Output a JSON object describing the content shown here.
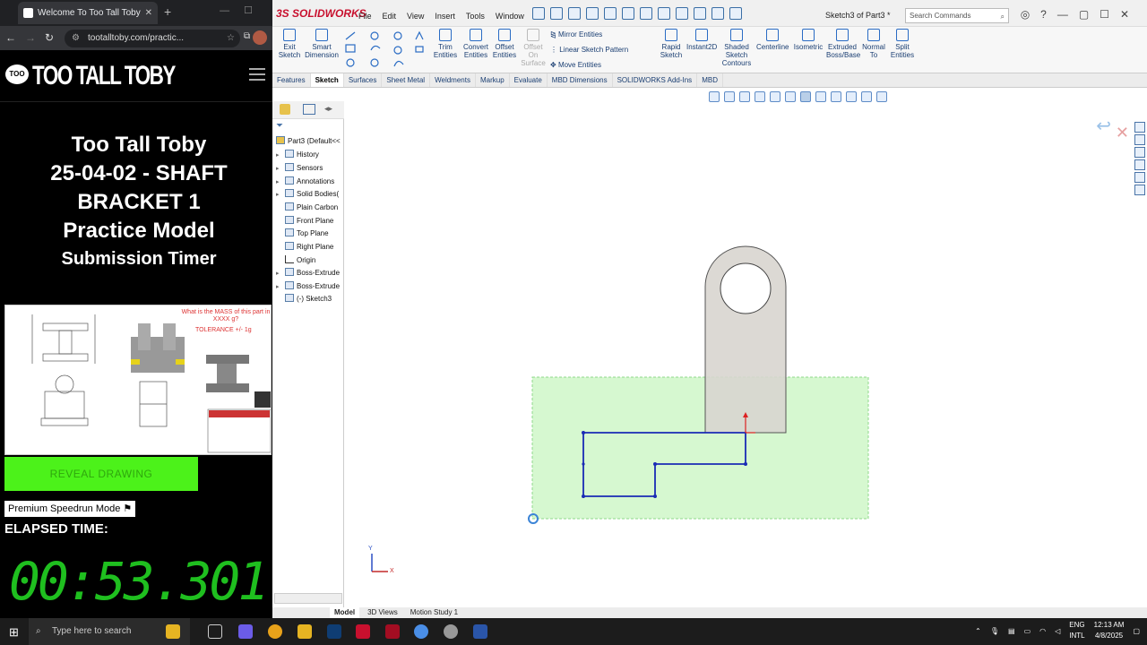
{
  "browser": {
    "tab_title": "Welcome To Too Tall Toby",
    "url": "tootalltoby.com/practic...",
    "logo_badge": "TOO",
    "logo_text": "TOO TALL TOBY",
    "heading_lines": [
      "Too Tall Toby",
      "25-04-02 - SHAFT",
      "BRACKET 1",
      "Practice Model"
    ],
    "subheading": "Submission Timer",
    "reveal_button": "REVEAL DRAWING",
    "speedrun_label": "Premium Speedrun Mode ⚑",
    "elapsed_label": "ELAPSED TIME:",
    "elapsed_value": "00:53.301",
    "drawing_question": "What is the MASS of this part in XXXX g?",
    "drawing_tolerance": "TOLERANCE +/- 1g"
  },
  "solidworks": {
    "brand": "3S SOLIDWORKS",
    "menus": [
      "File",
      "Edit",
      "View",
      "Insert",
      "Tools",
      "Window"
    ],
    "doc_title": "Sketch3 of Part3 *",
    "search_placeholder": "Search Commands",
    "commands": {
      "exit_sketch": "Exit Sketch",
      "smart_dimension": "Smart Dimension",
      "trim": "Trim Entities",
      "convert": "Convert Entities",
      "offset": "Offset Entities",
      "offset_surface": "Offset On Surface",
      "mirror": "Mirror Entities",
      "linear_pattern": "Linear Sketch Pattern",
      "move": "Move Entities",
      "rapid_sketch": "Rapid Sketch",
      "instant2d": "Instant2D",
      "shaded_contours": "Shaded Sketch Contours",
      "centerline": "Centerline",
      "isometric": "Isometric",
      "extruded_boss": "Extruded Boss/Base",
      "normal_to": "Normal To",
      "split_entities": "Split Entities"
    },
    "cmd_tabs": [
      "Features",
      "Sketch",
      "Surfaces",
      "Sheet Metal",
      "Weldments",
      "Markup",
      "Evaluate",
      "MBD Dimensions",
      "SOLIDWORKS Add-Ins",
      "MBD"
    ],
    "active_tab": "Sketch",
    "tree": {
      "root": "Part3  (Default<<",
      "items": [
        {
          "label": "History",
          "expandable": true
        },
        {
          "label": "Sensors",
          "expandable": true
        },
        {
          "label": "Annotations",
          "expandable": true
        },
        {
          "label": "Solid Bodies(",
          "expandable": true
        },
        {
          "label": "Plain Carbon",
          "expandable": false
        },
        {
          "label": "Front Plane",
          "expandable": false
        },
        {
          "label": "Top Plane",
          "expandable": false
        },
        {
          "label": "Right Plane",
          "expandable": false
        },
        {
          "label": "Origin",
          "expandable": false
        },
        {
          "label": "Boss-Extrude",
          "expandable": true
        },
        {
          "label": "Boss-Extrude",
          "expandable": true
        },
        {
          "label": "(-) Sketch3",
          "expandable": false
        }
      ]
    },
    "bottom_tabs": [
      "Model",
      "3D Views",
      "Motion Study 1"
    ],
    "axis_x": "X",
    "axis_y": "Y"
  },
  "taskbar": {
    "search_placeholder": "Type here to search",
    "language": "ENG",
    "layout": "INTL",
    "time": "12:13 AM",
    "date": "4/8/2025"
  },
  "colors": {
    "timer_green": "#1fbf1f",
    "reveal_green": "#4cf21a",
    "sketch_blue": "#1a2bb5",
    "selection_green": "#c8f5c0"
  }
}
